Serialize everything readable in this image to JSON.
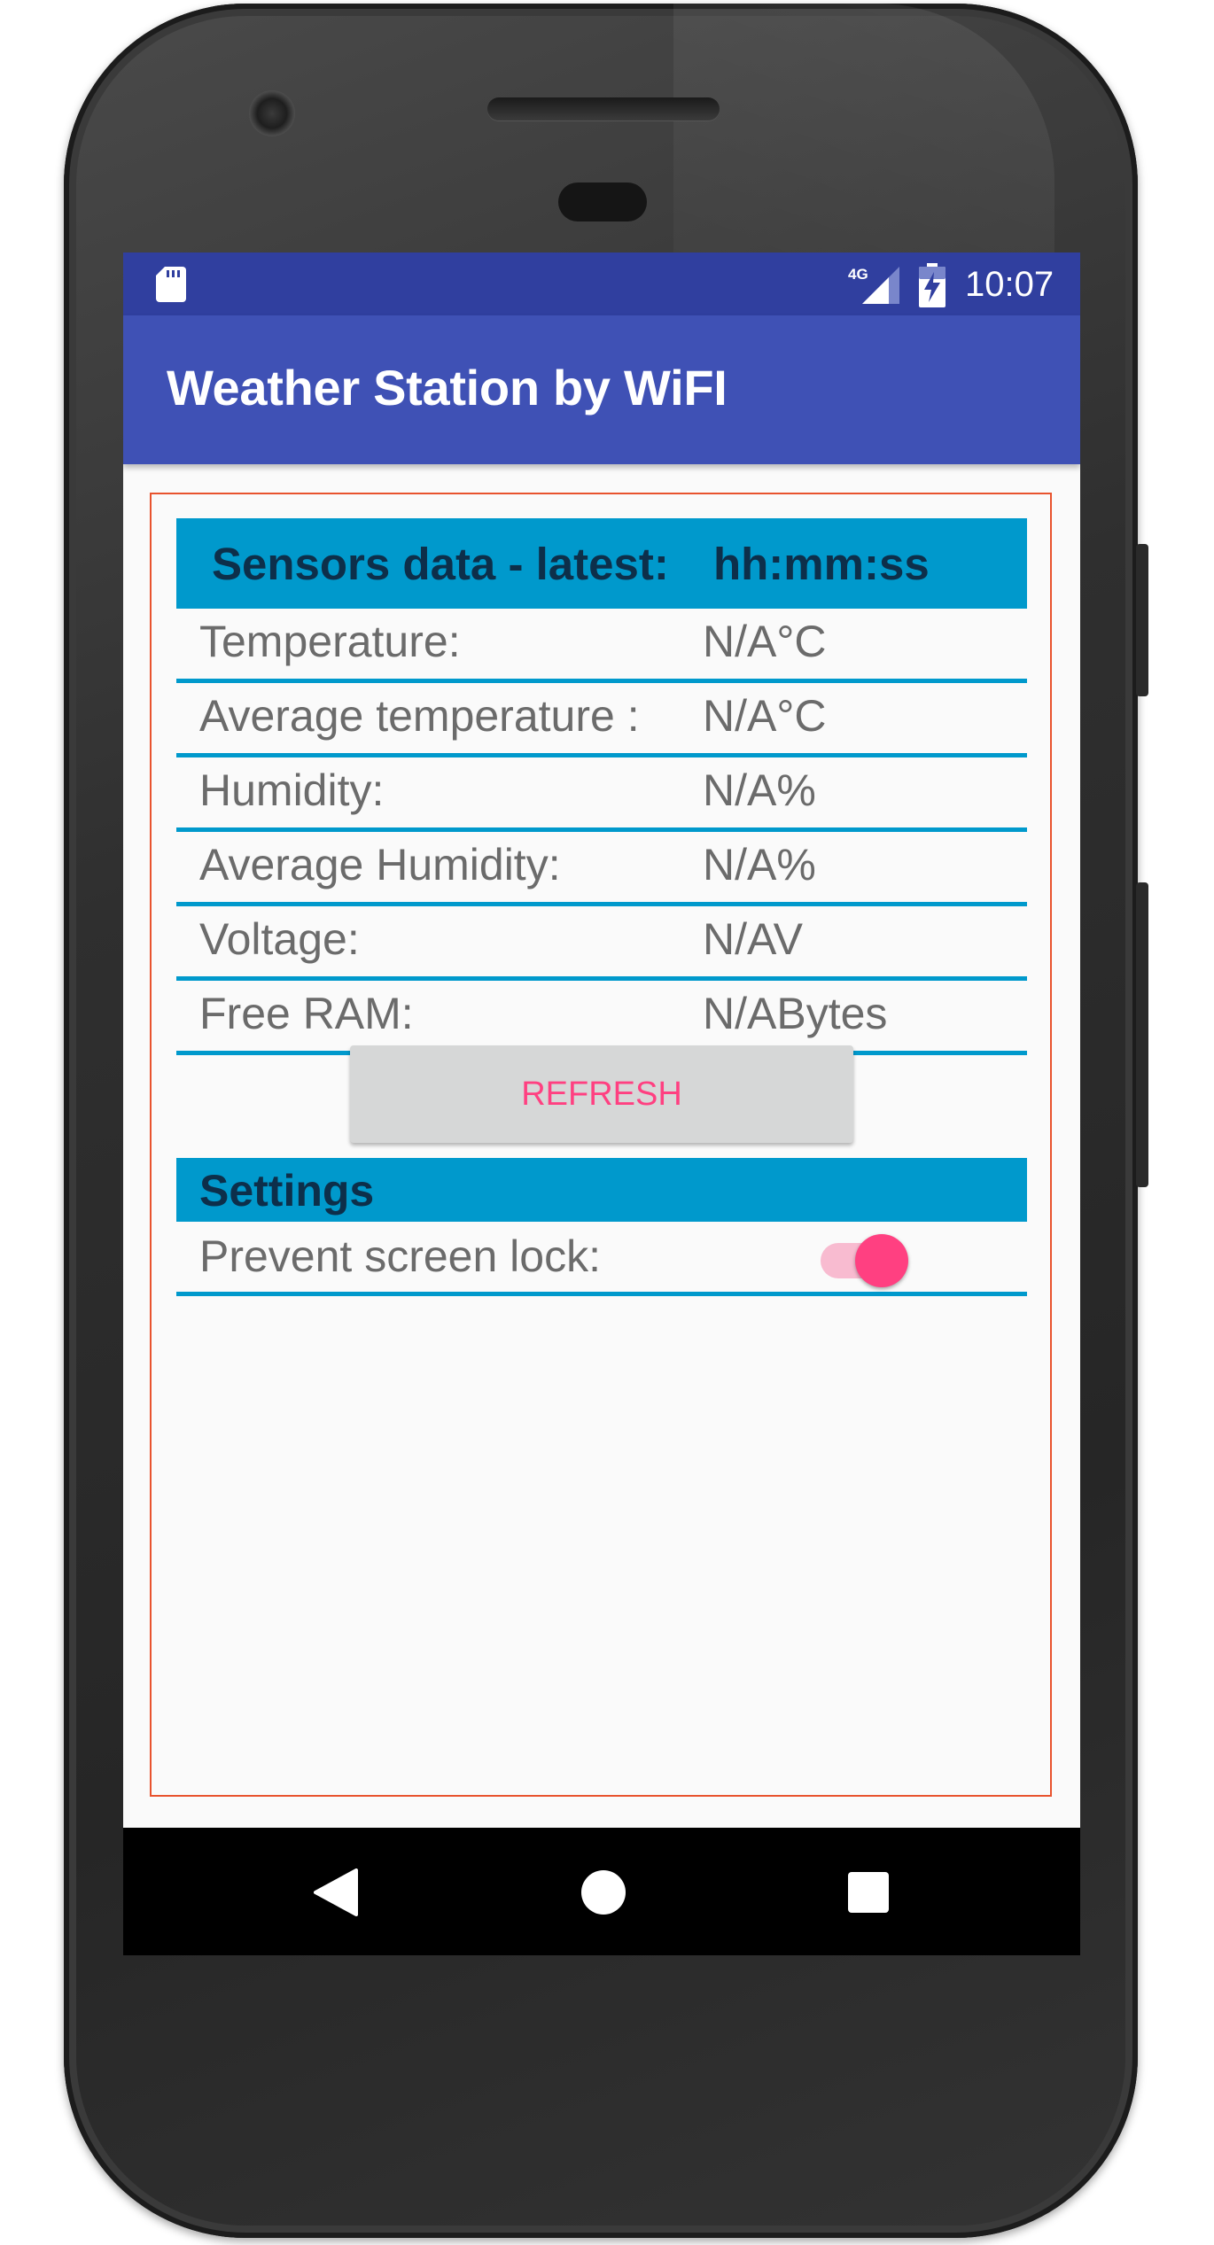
{
  "status_bar": {
    "time": "10:07",
    "network": "4G",
    "icons": [
      "sd-card-icon",
      "signal-4g-icon",
      "battery-charging-icon"
    ]
  },
  "app_bar": {
    "title": "Weather Station by WiFI"
  },
  "sensors": {
    "header_label": "Sensors data - latest:",
    "header_time": "hh:mm:ss",
    "rows": [
      {
        "label": "Temperature:",
        "value": "N/A°C"
      },
      {
        "label": "Average temperature :",
        "value": "N/A°C"
      },
      {
        "label": "Humidity:",
        "value": "N/A%"
      },
      {
        "label": "Average Humidity:",
        "value": "N/A%"
      },
      {
        "label": "Voltage:",
        "value": "N/AV"
      },
      {
        "label": "Free RAM:",
        "value": "N/ABytes"
      }
    ]
  },
  "refresh_button": {
    "label": "REFRESH"
  },
  "settings": {
    "title": "Settings",
    "prevent_screen_lock": {
      "label": "Prevent screen lock:",
      "enabled": true
    }
  },
  "nav_bar": {
    "icons": [
      "back-icon",
      "home-icon",
      "recents-icon"
    ]
  },
  "colors": {
    "status_bar": "#303f9f",
    "app_bar": "#3f51b5",
    "accent": "#ff4081",
    "section_header": "#0099cc"
  }
}
